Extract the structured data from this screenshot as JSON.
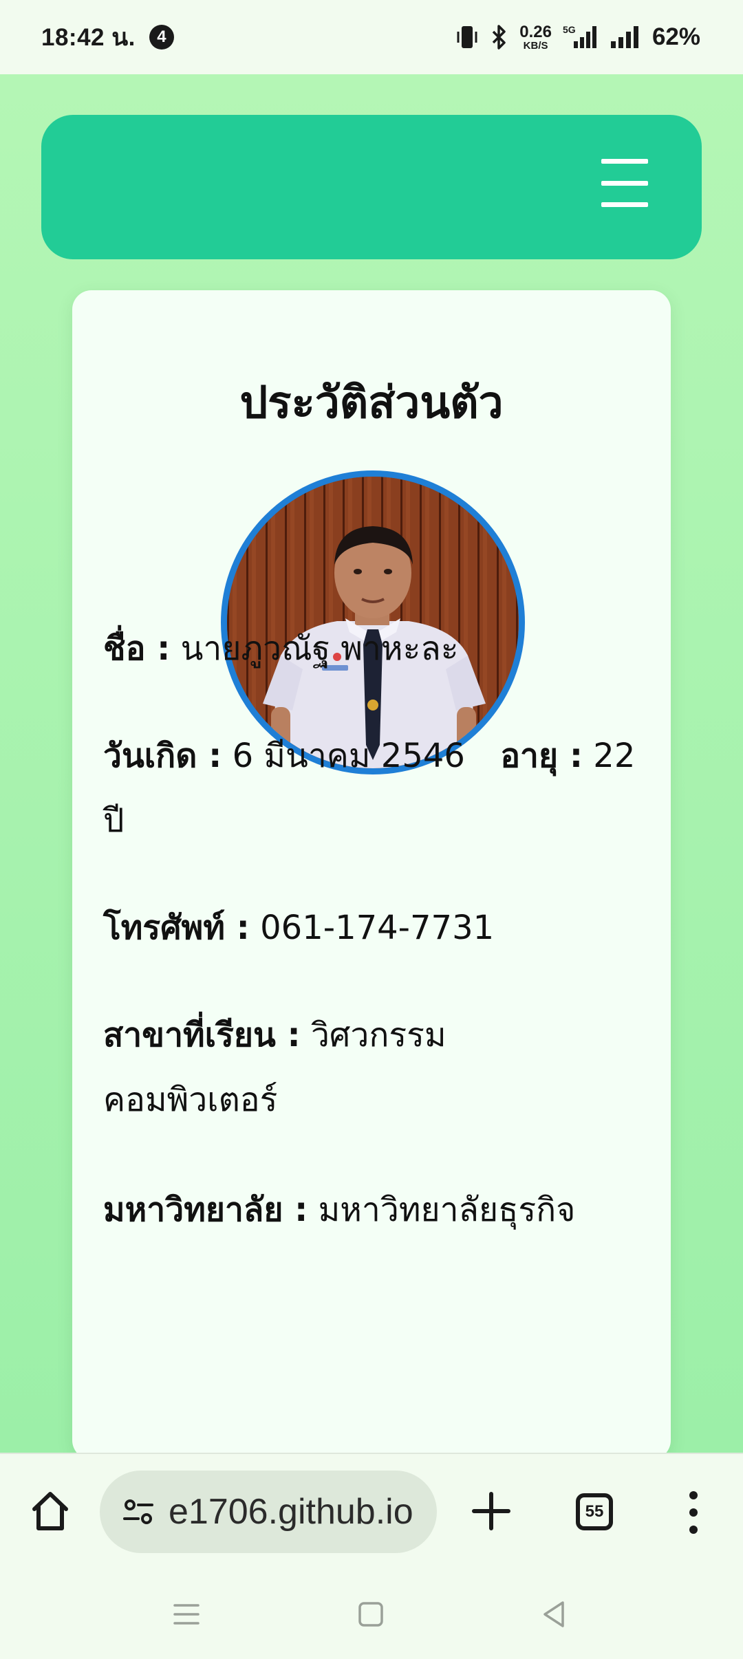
{
  "status_bar": {
    "time": "18:42 น.",
    "notification_count": "4",
    "net_speed_value": "0.26",
    "net_speed_unit": "KB/S",
    "network_type": "5G",
    "battery": "62%"
  },
  "header": {
    "menu_icon": "hamburger-menu-icon",
    "accent_color": "#22cc96"
  },
  "profile": {
    "title": "ประวัติส่วนตัว",
    "name_label": "ชื่อ :",
    "name_value": "นายภูวณัฐ พาหะละ",
    "birth_label": "วันเกิด :",
    "birth_value": "6 มีนาคม 2546",
    "age_label": "อายุ :",
    "age_value": "22 ปี",
    "phone_label": "โทรศัพท์ :",
    "phone_value": "061-174-7731",
    "major_label": "สาขาที่เรียน :",
    "major_value": "วิศวกรรมคอมพิวเตอร์",
    "university_label": "มหาวิทยาลัย :",
    "university_value": "มหาวิทยาลัยธุรกิจ"
  },
  "browser": {
    "url": "e1706.github.io",
    "tab_count": "55"
  }
}
